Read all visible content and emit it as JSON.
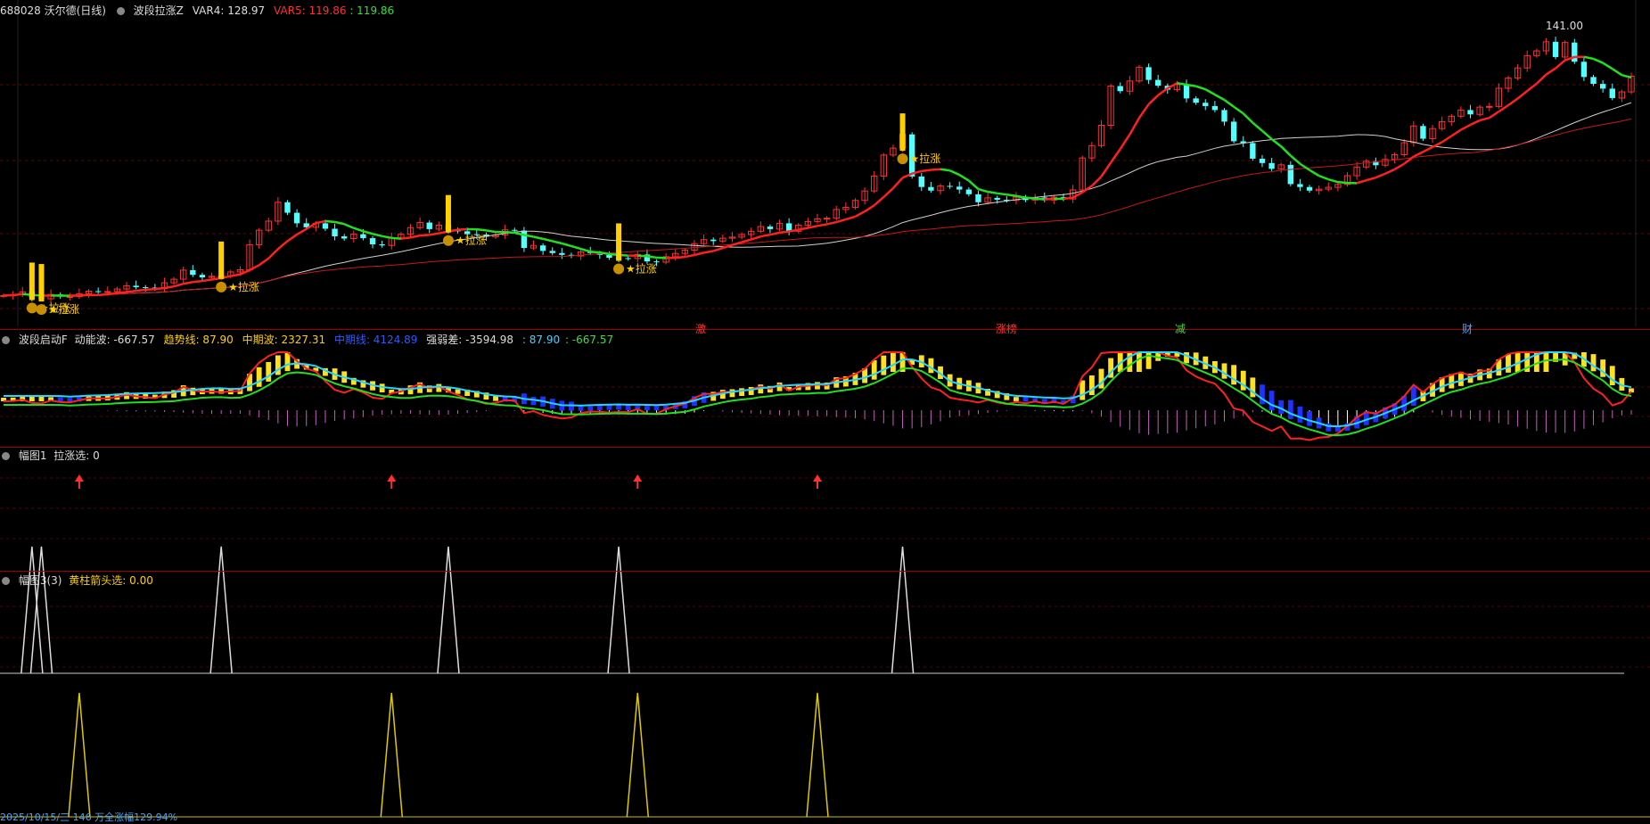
{
  "header": {
    "stock": "688028 沃尔德(日线)",
    "indicator": "波段拉涨Z",
    "var4": "VAR4: 128.97",
    "var5": "VAR5: 119.86",
    "var5b": ": 119.86",
    "max_label": "141.00"
  },
  "panel2": {
    "name": "波段启动F",
    "v1": "动能波: -667.57",
    "v2": "趋势线: 87.90",
    "v3": "中期波: 2327.31",
    "v4": "中期线: 4124.89",
    "v5": "强弱差: -3594.98",
    "v6": ": 87.90",
    "v7": ": -667.57"
  },
  "panel3": {
    "name": "幅图1",
    "value": "拉涨选: 0"
  },
  "panel4": {
    "name": "幅图3(3)",
    "value": "黄柱箭头选: 0.00"
  },
  "status": "2025/10/15/三 146 万全涨幅129.94%",
  "event_tags": [
    "激",
    "涨榜",
    "减",
    "财"
  ],
  "signal_label": "拉涨",
  "colors": {
    "up": "#ff3030",
    "down": "#54ffff",
    "ma_fast": "#ff2020",
    "ma_green": "#20e020",
    "ma_white": "#d0d0d0",
    "signal": "#ffd000",
    "separator": "#a00000"
  },
  "chart_data": {
    "type": "candlestick",
    "ylim": [
      60,
      145
    ],
    "closes": [
      68.5,
      68.7,
      69.5,
      68.0,
      67.6,
      68.8,
      68.2,
      68.2,
      69.0,
      69.7,
      69.6,
      69.6,
      70.3,
      71.2,
      70.8,
      70.7,
      70.4,
      72.0,
      73.0,
      75.5,
      74.2,
      73.5,
      73.8,
      73.9,
      75.0,
      75.6,
      82.5,
      86.5,
      89.0,
      94.2,
      91.3,
      88.4,
      87.3,
      88.4,
      86.9,
      84.8,
      84.2,
      85.4,
      84.3,
      82.6,
      82.3,
      84.4,
      85.4,
      87.2,
      88.6,
      86.8,
      87.9,
      86.6,
      86.2,
      85.4,
      85.3,
      84.7,
      85.2,
      86.6,
      86.4,
      81.6,
      82.3,
      80.8,
      80.2,
      79.7,
      79.4,
      80.5,
      80.2,
      79.7,
      78.9,
      78.8,
      78.7,
      79.8,
      77.9,
      77.7,
      79.2,
      80.1,
      81.0,
      82.8,
      83.9,
      83.5,
      84.3,
      84.6,
      85.3,
      86.2,
      87.5,
      86.8,
      88.4,
      86.2,
      87.9,
      88.9,
      89.6,
      89.8,
      92.2,
      92.8,
      94.7,
      97.3,
      101.4,
      107.2,
      109.1,
      112.9,
      101.3,
      98.4,
      97.4,
      98.7,
      98.5,
      97.7,
      96.4,
      94.2,
      95.4,
      94.9,
      94.7,
      95.6,
      94.8,
      95.5,
      94.8,
      95.6,
      95.1,
      97.6,
      106.4,
      109.8,
      115.4,
      126.2,
      124.8,
      127.6,
      131.4,
      127.9,
      126.3,
      125.2,
      126.6,
      122.8,
      121.6,
      120.7,
      119.6,
      116.4,
      111.0,
      110.5,
      106.2,
      105.0,
      103.4,
      104.5,
      99.2,
      98.4,
      97.4,
      97.8,
      98.3,
      99.1,
      101.5,
      103.9,
      105.5,
      104.4,
      106.0,
      107.3,
      110.6,
      115.2,
      111.7,
      114.5,
      116.4,
      117.9,
      119.6,
      118.4,
      120.4,
      120.6,
      125.6,
      128.4,
      131.2,
      134.6,
      135.9,
      138.4,
      134.2,
      138.2,
      132.9,
      128.7,
      126.8,
      125.5,
      122.9,
      124.6,
      128.9
    ],
    "signals_lazhang": [
      3,
      4,
      23,
      47,
      65,
      95
    ],
    "signals_yellow_arrow": [
      8,
      41,
      67,
      86
    ],
    "ma_note": "multiple moving averages on price panel"
  }
}
